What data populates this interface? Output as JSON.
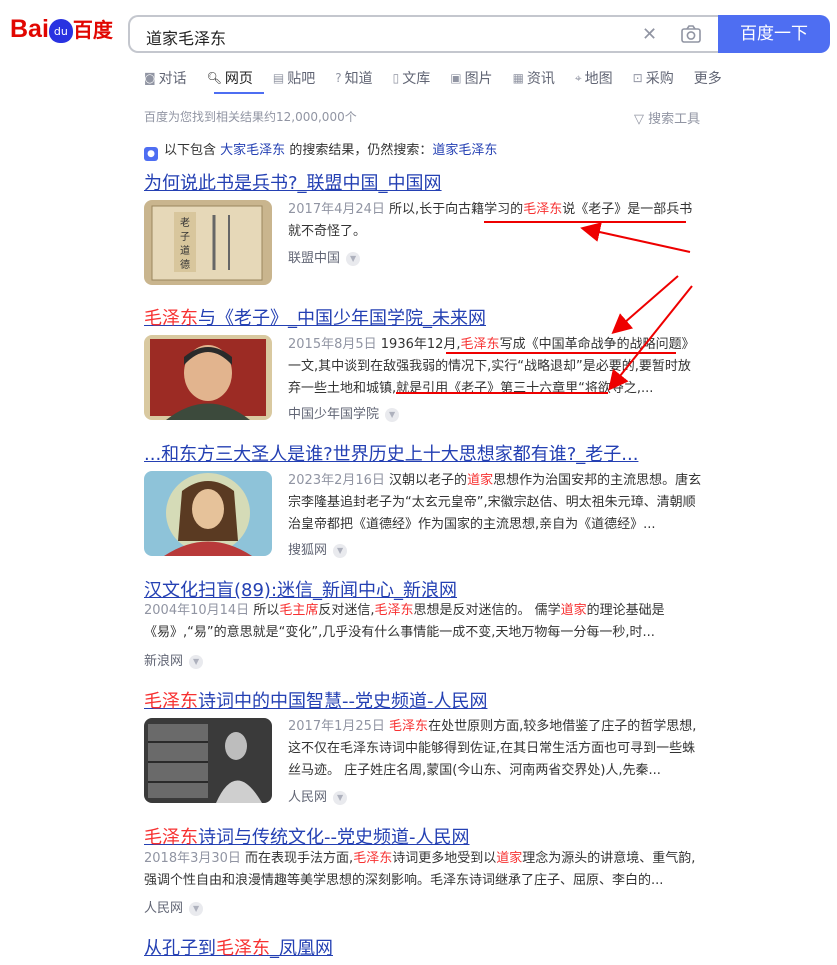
{
  "header": {
    "logo": {
      "bai": "Bai",
      "du": "du",
      "cn": "百度"
    },
    "query": "道家毛泽东",
    "search_button": "百度一下"
  },
  "tabs": [
    {
      "icon": "ai-chat-icon",
      "label": "对话"
    },
    {
      "icon": "search-icon",
      "label": "网页"
    },
    {
      "icon": "tieba-icon",
      "label": "贴吧"
    },
    {
      "icon": "zhidao-icon",
      "label": "知道"
    },
    {
      "icon": "wenku-icon",
      "label": "文库"
    },
    {
      "icon": "image-icon",
      "label": "图片"
    },
    {
      "icon": "news-icon",
      "label": "资讯"
    },
    {
      "icon": "map-icon",
      "label": "地图"
    },
    {
      "icon": "shopping-icon",
      "label": "采购"
    },
    {
      "icon": "",
      "label": "更多"
    }
  ],
  "result_count": "百度为您找到相关结果约12,000,000个",
  "search_tools": "搜索工具",
  "notice": {
    "prefix": "以下包含",
    "suggested": "大家毛泽东",
    "middle": "的搜索结果，仍然搜索：",
    "original": "道家毛泽东"
  },
  "results": [
    {
      "title": [
        "为何说此书是兵书?_联盟中国_中国网"
      ],
      "date": "2017年4月24日",
      "snippet": [
        "所以,长于向古籍学习的",
        "毛泽东",
        "说《老子》是一部兵书就不奇怪了。"
      ],
      "source": "联盟中国"
    },
    {
      "title": [
        "毛泽东",
        "与《老子》_中国少年国学院_未来网"
      ],
      "date": "2015年8月5日",
      "snippet": [
        "1936年12月,",
        "毛泽东",
        "写成《中国革命战争的战略问题》一文,其中谈到在敌强我弱的情况下,实行“战略退却”是必要的,要暂时放弃一些土地和城镇,就是引用《老子》第三十六章里“将欲夺之,..."
      ],
      "source": "中国少年国学院"
    },
    {
      "title": [
        "...和东方三大圣人是谁?世界历史上十大思想家都有谁?_老子..."
      ],
      "date": "2023年2月16日",
      "snippet": [
        "汉朝以老子的",
        "道家",
        "思想作为治国安邦的主流思想。唐玄宗李隆基追封老子为“太玄元皇帝”,宋徽宗赵佶、明太祖朱元璋、清朝顺治皇帝都把《道德经》作为国家的主流思想,亲自为《道德经》..."
      ],
      "source": "搜狐网"
    },
    {
      "title": [
        "汉文化扫盲(89):迷信_新闻中心_新浪网"
      ],
      "date": "2004年10月14日",
      "snippet": [
        "所以",
        "毛主席",
        "反对迷信,",
        "毛泽东",
        "思想是反对迷信的。 儒学",
        "道家",
        "的理论基础是《易》,“易”的意思就是“变化”,几乎没有什么事情能一成不变,天地万物每一分每一秒,时..."
      ],
      "source": "新浪网"
    },
    {
      "title": [
        "毛泽东",
        "诗词中的中国智慧--党史频道-人民网"
      ],
      "date": "2017年1月25日",
      "snippet": [
        "毛泽东",
        "在处世原则方面,较多地借鉴了庄子的哲学思想,这不仅在毛泽东诗词中能够得到佐证,在其日常生活方面也可寻到一些蛛丝马迹。 庄子姓庄名周,蒙国(今山东、河南两省交界处)人,先秦..."
      ],
      "source": "人民网"
    },
    {
      "title": [
        "毛泽东",
        "诗词与传统文化--党史频道-人民网"
      ],
      "date": "2018年3月30日",
      "snippet": [
        "而在表现手法方面,",
        "毛泽东",
        "诗词更多地受到以",
        "道家",
        "理念为源头的讲意境、重气韵,强调个性自由和浪漫情趣等美学思想的深刻影响。毛泽东诗词继承了庄子、屈原、李白的..."
      ],
      "source": "人民网"
    },
    {
      "title": [
        "从孔子到",
        "毛泽东",
        "_凤凰网"
      ]
    }
  ],
  "colors": {
    "accent": "#4e6ef2",
    "link": "#2440b3",
    "highlight": "#f73131",
    "annotation": "#ee0000"
  }
}
